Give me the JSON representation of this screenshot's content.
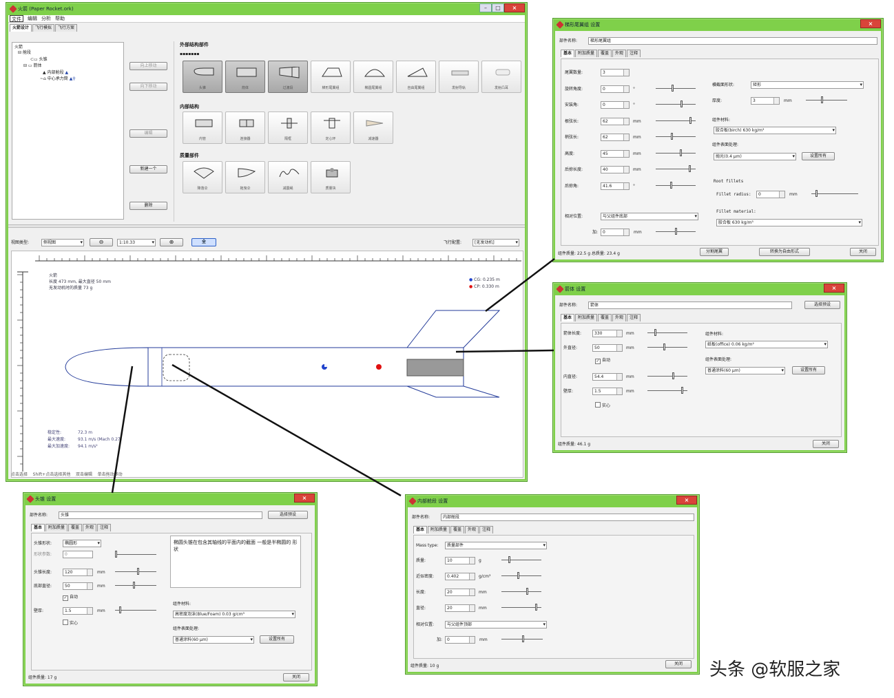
{
  "main_window": {
    "title": "火箭 (Paper Rocket.ork)",
    "menu": [
      "文件",
      "编辑",
      "分析",
      "帮助"
    ],
    "tabs": [
      "火箭设计",
      "飞行模拟",
      "飞行方案"
    ],
    "tree": [
      "火箭",
      "舱段",
      "头锥",
      "箭体",
      "内部舱段",
      "中心承力筒"
    ],
    "side_buttons": [
      "向上移动",
      "向下移动",
      "编辑",
      "新建一个",
      "删除"
    ],
    "sections": {
      "outer": "外部结构部件",
      "inner": "内部结构",
      "mass": "质量部件"
    },
    "outer_components": [
      "头锥",
      "箭体",
      "过渡段",
      "梯形尾翼组",
      "椭圆尾翼组",
      "自由尾翼组",
      "发射导轨",
      "发射凸耳"
    ],
    "inner_components": [
      "内管",
      "连接器",
      "隔框",
      "定心环",
      "减速器"
    ],
    "mass_components": [
      "降落伞",
      "拖曳伞",
      "减震绳",
      "质量块"
    ],
    "toolbar": {
      "view_label": "视图类型:",
      "view_value": "侧视图",
      "zoom_value": "1:10.33",
      "flight_label": "飞行配置:",
      "flight_value": "[无发动机]",
      "stage_btn": "全"
    },
    "rocket_info": [
      "火箭",
      "长度 473 mm, 最大直径 50 mm",
      "无发动机时的质量 73 g"
    ],
    "legend": [
      "CG: 0.235 m",
      "CP: 0.330 m"
    ],
    "stats": [
      [
        "稳定性:",
        "72.3 m"
      ],
      [
        "最大速度:",
        "93.1 m/s (Mach 0.27)"
      ],
      [
        "最大加速度:",
        "94.1 m/s²"
      ]
    ],
    "statusbar": [
      "点击选择",
      "Shift+点击选择其他",
      "双击编辑",
      "单击拖动移动"
    ]
  },
  "fin_dialog": {
    "title": "梯形尾翼组 设置",
    "name_label": "部件名称:",
    "name_value": "梯形尾翼组",
    "tabs": [
      "基本",
      "附加质量",
      "覆盖",
      "外观",
      "注释"
    ],
    "rows": [
      {
        "label": "尾翼数量:",
        "value": "3",
        "unit": ""
      },
      {
        "label": "旋转角度:",
        "value": "0",
        "unit": "°"
      },
      {
        "label": "安装角:",
        "value": "0",
        "unit": "°"
      },
      {
        "label": "根弦长:",
        "value": "62",
        "unit": "mm"
      },
      {
        "label": "梢弦长:",
        "value": "62",
        "unit": "mm"
      },
      {
        "label": "高度:",
        "value": "45",
        "unit": "mm"
      },
      {
        "label": "后掠长度:",
        "value": "40",
        "unit": "mm"
      },
      {
        "label": "后掠角:",
        "value": "41.6",
        "unit": "°"
      }
    ],
    "position_label": "相对位置:",
    "position_value": "与父组件底部",
    "plus_label": "加:",
    "plus_value": "0",
    "cross_label": "横截面形状:",
    "cross_value": "矩形",
    "thick_label": "厚度:",
    "thick_value": "3",
    "material_label": "组件材料:",
    "material_value": "胶合板(birch) 630 kg/m³",
    "finish_label": "组件表面处理:",
    "finish_value": "抛光(0.4 μm)",
    "finish_btn": "设置所有",
    "fillet_label": "Root fillets",
    "fillet_radius_label": "Fillet radius:",
    "fillet_radius_value": "0",
    "fillet_material_label": "Fillet material:",
    "fillet_material_value": "胶合板 630 kg/m³",
    "mass_status": "组件质量: 22.5 g   总质量: 23.4 g",
    "btn_split": "分割尾翼",
    "btn_convert": "转换为自由形式",
    "btn_close": "关闭"
  },
  "body_dialog": {
    "title": "箭体 设置",
    "name_label": "部件名称:",
    "name_value": "箭体",
    "preset_btn": "选择预设",
    "tabs": [
      "基本",
      "附加质量",
      "覆盖",
      "外观",
      "注释"
    ],
    "rows": [
      {
        "label": "箭体长度:",
        "value": "330",
        "unit": "mm"
      },
      {
        "label": "外直径:",
        "value": "50",
        "unit": "mm"
      },
      {
        "label": "内直径:",
        "value": "54.4",
        "unit": "mm"
      },
      {
        "label": "壁厚:",
        "value": "1.5",
        "unit": "mm"
      }
    ],
    "auto_check": "自动",
    "solid_check": "实心",
    "material_label": "组件材料:",
    "material_value": "纸板(office) 0.06 kg/m²",
    "finish_label": "组件表面处理:",
    "finish_value": "普通涂料(60 μm)",
    "finish_btn": "设置所有",
    "mass_status": "组件质量: 46.1 g",
    "btn_close": "关闭"
  },
  "nose_dialog": {
    "title": "头锥 设置",
    "name_label": "部件名称:",
    "name_value": "头锥",
    "preset_btn": "选择预设",
    "tabs": [
      "基本",
      "附加质量",
      "覆盖",
      "外观",
      "注释"
    ],
    "shape_label": "头锥形状:",
    "shape_value": "椭圆形",
    "param_label": "形状参数:",
    "param_value": "0",
    "len_label": "头锥长度:",
    "len_value": "120",
    "len_unit": "mm",
    "base_label": "底部直径:",
    "base_value": "50",
    "base_unit": "mm",
    "auto_check": "自动",
    "wall_label": "壁厚:",
    "wall_value": "1.5",
    "wall_unit": "mm",
    "solid_check": "实心",
    "desc": "椭圆头锥在包含其轴线的平面内的截面 一般是半椭圆的 形状",
    "material_label": "组件材料:",
    "material_value": "高密度泡沫(Blue/Foam) 0.03 g/cm³",
    "finish_label": "组件表面处理:",
    "finish_value": "普通涂料(60 μm)",
    "finish_btn": "设置所有",
    "mass_status": "组件质量: 17 g",
    "btn_close": "关闭"
  },
  "inner_dialog": {
    "title": "内部舱段 设置",
    "name_label": "部件名称:",
    "name_value": "内部舱段",
    "tabs": [
      "基本",
      "附加质量",
      "覆盖",
      "外观",
      "注释"
    ],
    "type_label": "Mass type:",
    "type_value": "质量部件",
    "rows": [
      {
        "label": "质量:",
        "value": "10",
        "unit": "g"
      },
      {
        "label": "近似密度:",
        "value": "0.402",
        "unit": "g/cm³"
      },
      {
        "label": "长度:",
        "value": "20",
        "unit": "mm"
      },
      {
        "label": "直径:",
        "value": "20",
        "unit": "mm"
      }
    ],
    "position_label": "相对位置:",
    "position_value": "与父组件顶部",
    "plus_label": "加:",
    "plus_value": "0",
    "plus_unit": "mm",
    "mass_status": "组件质量: 10 g",
    "btn_close": "关闭"
  },
  "watermark": "头条 @软服之家"
}
